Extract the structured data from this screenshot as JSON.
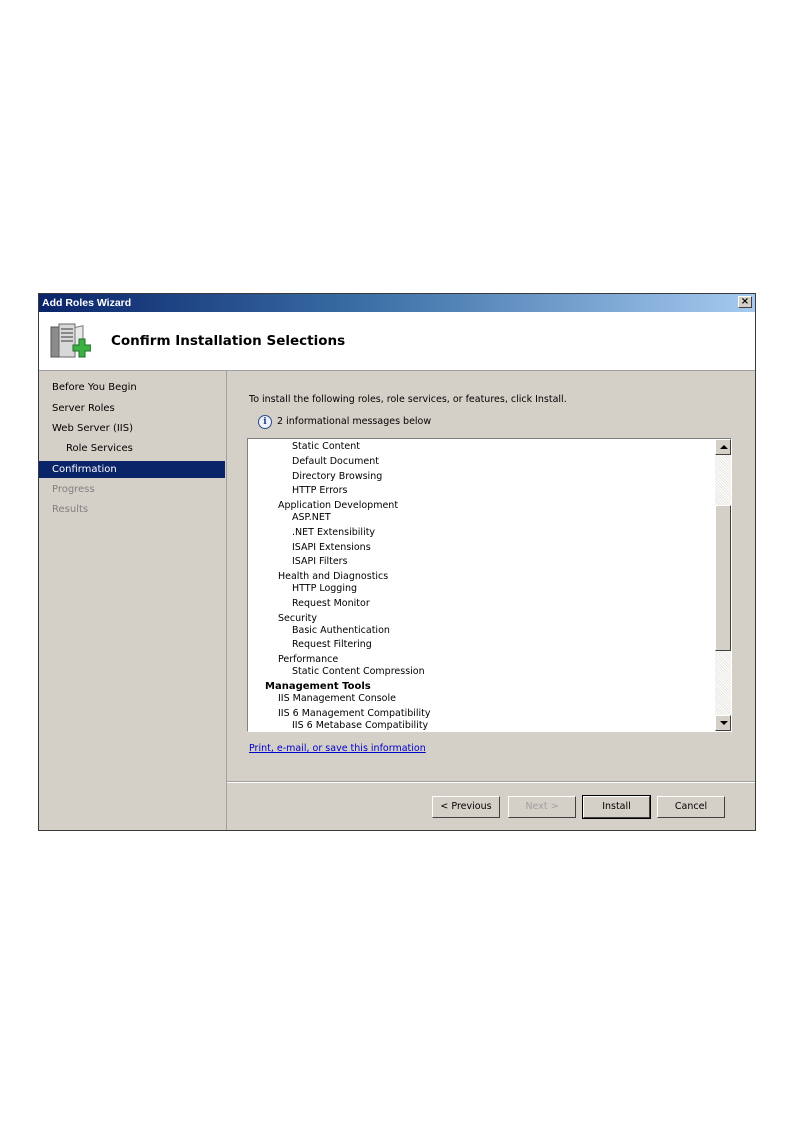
{
  "window": {
    "title": "Add Roles Wizard",
    "close_glyph": "×",
    "header_title": "Confirm Installation Selections",
    "header_icon": "server-add-icon"
  },
  "sidebar": {
    "items": [
      {
        "label": "Before You Begin"
      },
      {
        "label": "Server Roles"
      },
      {
        "label": "Web Server (IIS)"
      },
      {
        "label": "Role Services"
      },
      {
        "label": "Confirmation"
      },
      {
        "label": "Progress"
      },
      {
        "label": "Results"
      }
    ],
    "active_color": "#0a246a"
  },
  "main": {
    "intro": "To install the following roles, role services, or features, click Install.",
    "info_icon": "i",
    "info_text": "2 informational messages below",
    "list": [
      "Static Content",
      "Default Document",
      "Directory Browsing",
      "HTTP Errors",
      "Application Development",
      "ASP.NET",
      ".NET Extensibility",
      "ISAPI Extensions",
      "ISAPI Filters",
      "Health and Diagnostics",
      "HTTP Logging",
      "Request Monitor",
      "Security",
      "Basic Authentication",
      "Request Filtering",
      "Performance",
      "Static Content Compression",
      "Management Tools",
      "IIS Management Console",
      "IIS 6 Management Compatibility",
      "IIS 6 Metabase Compatibility"
    ],
    "link": "Print, e-mail, or save this information"
  },
  "buttons": {
    "previous": "< Previous",
    "next": "Next >",
    "install": "Install",
    "cancel": "Cancel"
  }
}
